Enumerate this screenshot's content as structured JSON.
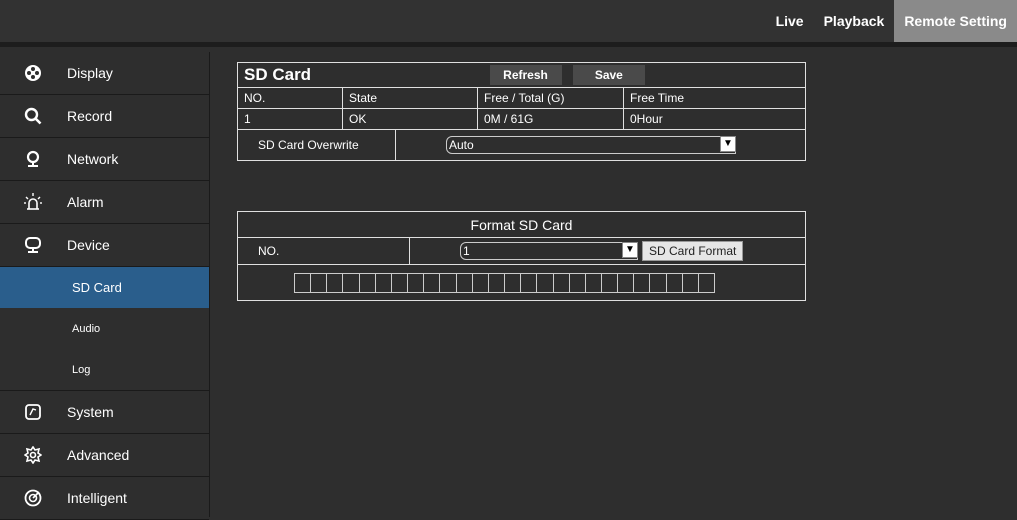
{
  "topnav": {
    "items": [
      {
        "label": "Live",
        "active": false
      },
      {
        "label": "Playback",
        "active": false
      },
      {
        "label": "Remote Setting",
        "active": true
      }
    ]
  },
  "sidebar": {
    "items": [
      {
        "label": "Display",
        "icon": "display-icon"
      },
      {
        "label": "Record",
        "icon": "search-icon"
      },
      {
        "label": "Network",
        "icon": "network-icon"
      },
      {
        "label": "Alarm",
        "icon": "alarm-icon"
      },
      {
        "label": "Device",
        "icon": "device-icon"
      },
      {
        "label": "System",
        "icon": "system-icon"
      },
      {
        "label": "Advanced",
        "icon": "gear-icon"
      },
      {
        "label": "Intelligent",
        "icon": "intelligent-icon"
      }
    ],
    "subitems": [
      {
        "label": "SD Card",
        "active": true
      },
      {
        "label": "Audio",
        "active": false
      },
      {
        "label": "Log",
        "active": false
      }
    ]
  },
  "sdcard": {
    "title": "SD Card",
    "refresh_label": "Refresh",
    "save_label": "Save",
    "headers": [
      "NO.",
      "State",
      "Free / Total (G)",
      "Free Time"
    ],
    "rows": [
      [
        "1",
        "OK",
        "0M / 61G",
        "0Hour"
      ]
    ],
    "overwrite_label": "SD Card Overwrite",
    "overwrite_value": "Auto"
  },
  "format": {
    "title": "Format SD Card",
    "no_label": "NO.",
    "no_value": "1",
    "format_button": "SD Card Format",
    "progress_fraction": 0,
    "progress_segments": 26
  },
  "colors": {
    "background": "#2e2e2e",
    "active_tab": "#8a8a8a",
    "active_subitem": "#2a5e8c"
  }
}
